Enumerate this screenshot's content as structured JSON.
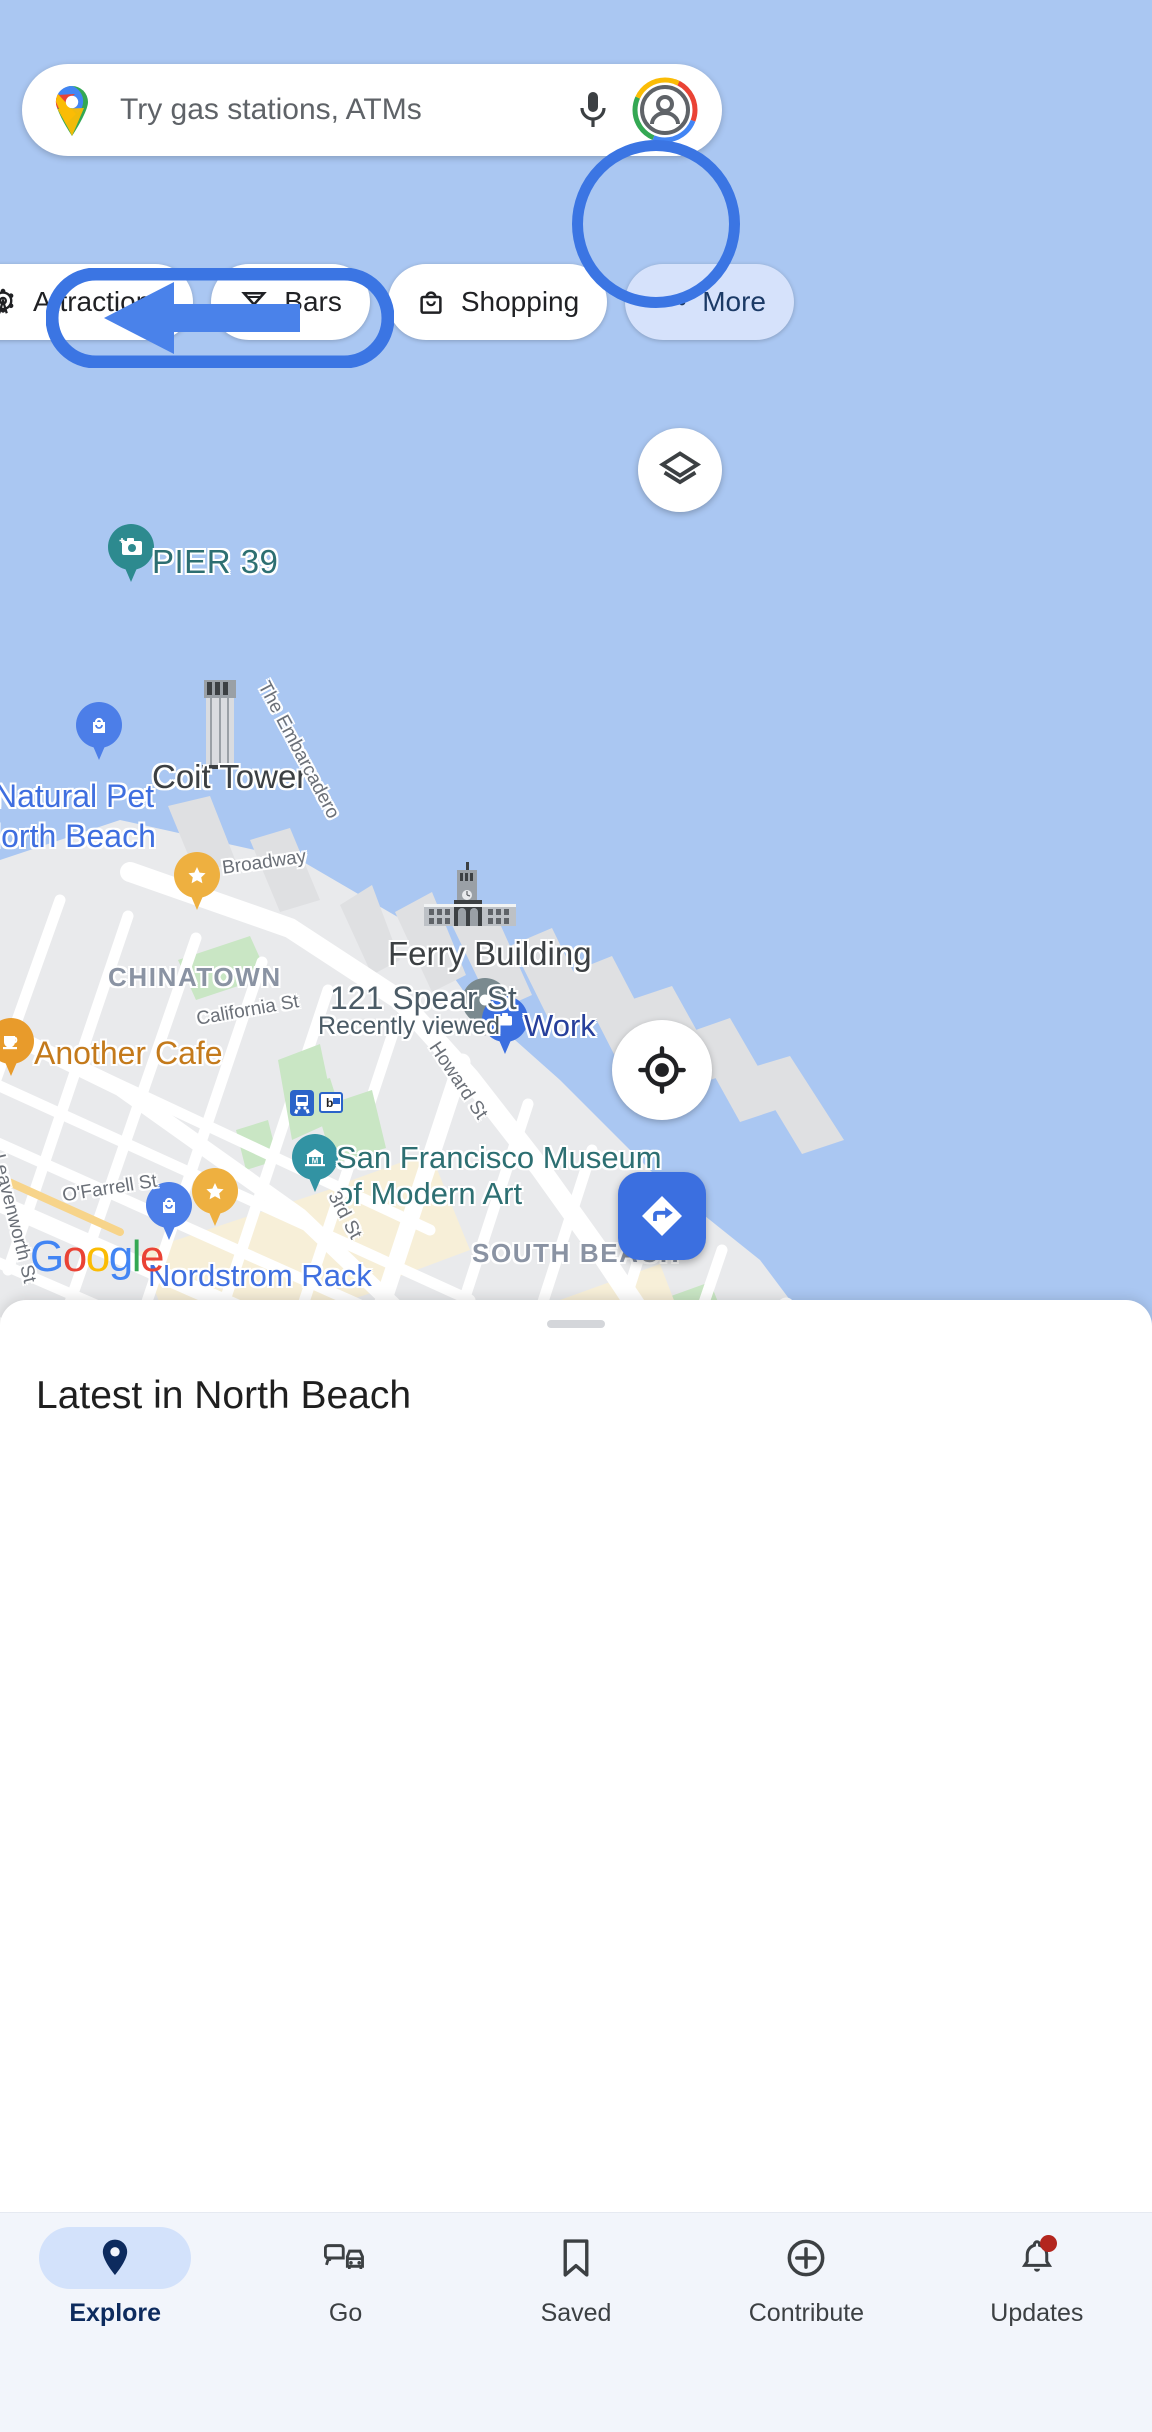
{
  "search": {
    "placeholder": "Try gas stations, ATMs",
    "logo_icon": "google-maps-pin-icon",
    "mic_icon": "microphone-icon",
    "avatar_icon": "account-avatar-icon"
  },
  "chips": [
    {
      "label": "Attractions",
      "icon": "ferris-wheel-icon",
      "active": false
    },
    {
      "label": "Bars",
      "icon": "cocktail-glass-icon",
      "active": false
    },
    {
      "label": "Shopping",
      "icon": "shopping-bag-icon",
      "active": false
    },
    {
      "label": "More",
      "icon": "three-dots-icon",
      "active": true
    }
  ],
  "map_controls": {
    "layers_icon": "layers-icon",
    "locate_icon": "my-location-icon",
    "directions_icon": "directions-arrow-icon"
  },
  "annotations": {
    "highlight_target": "More",
    "arrow_direction": "left",
    "accent_color": "#3b75e3"
  },
  "map": {
    "attribution": "Google",
    "attribution_letters": [
      {
        "ch": "G",
        "color": "#4285F4"
      },
      {
        "ch": "o",
        "color": "#EA4335"
      },
      {
        "ch": "o",
        "color": "#FBBC05"
      },
      {
        "ch": "g",
        "color": "#4285F4"
      },
      {
        "ch": "l",
        "color": "#34A853"
      },
      {
        "ch": "e",
        "color": "#EA4335"
      }
    ],
    "pois": [
      {
        "name": "PIER 39",
        "type": "attraction",
        "color": "#2d8a8f",
        "pin_icon": "camera-pin-icon"
      },
      {
        "name": "Coit Tower",
        "type": "landmark",
        "color": "#3c4043",
        "pin_icon": "tower-3d-icon"
      },
      {
        "name": "Natural Pet",
        "type": "shop",
        "color": "#3f6fe0",
        "pin_icon": "shopping-bag-pin-icon"
      },
      {
        "name": "North Beach",
        "type": "shop",
        "color": "#3f6fe0",
        "pin_icon": ""
      },
      {
        "name": "Ferry Building",
        "type": "landmark",
        "color": "#3c4043",
        "pin_icon": "ferry-building-3d-icon"
      },
      {
        "name": "121 Spear St",
        "type": "recent",
        "color": "#4b5b66",
        "pin_icon": "gray-pin-icon"
      },
      {
        "name": "Recently viewed",
        "type": "recent-sub",
        "color": "#4b5b66",
        "pin_icon": ""
      },
      {
        "name": "Work",
        "type": "saved",
        "color": "#27409c",
        "pin_icon": "briefcase-pin-icon"
      },
      {
        "name": "Another Cafe",
        "type": "cafe",
        "color": "#c47a1b",
        "pin_icon": "coffee-cup-pin-icon"
      },
      {
        "name": "San Francisco Museum",
        "type": "museum",
        "color": "#2d6f72",
        "pin_icon": "museum-pin-icon"
      },
      {
        "name": "of Modern Art",
        "type": "museum-sub",
        "color": "#2d6f72",
        "pin_icon": ""
      },
      {
        "name": "Nordstrom Rack",
        "type": "shop",
        "color": "#3f6fe0",
        "pin_icon": "blue-pin-icon"
      }
    ],
    "neighborhoods": [
      "CHINATOWN",
      "SOUTH BEACH"
    ],
    "streets": [
      "The Embarcadero",
      "Broadway",
      "California St",
      "Howard St",
      "O'Farrell St",
      "Leavenworth St",
      "3rd St"
    ],
    "starred_pins": 2,
    "transit_icons": [
      "train-station-icon",
      "bart-station-icon"
    ]
  },
  "sheet": {
    "title": "Latest in North Beach",
    "grabber": "drag-handle"
  },
  "bottom_nav": [
    {
      "label": "Explore",
      "icon": "location-pin-icon",
      "active": true,
      "badge": false
    },
    {
      "label": "Go",
      "icon": "commute-icon",
      "active": false,
      "badge": false
    },
    {
      "label": "Saved",
      "icon": "bookmark-icon",
      "active": false,
      "badge": false
    },
    {
      "label": "Contribute",
      "icon": "plus-circle-icon",
      "active": false,
      "badge": false
    },
    {
      "label": "Updates",
      "icon": "bell-icon",
      "active": false,
      "badge": true
    }
  ]
}
